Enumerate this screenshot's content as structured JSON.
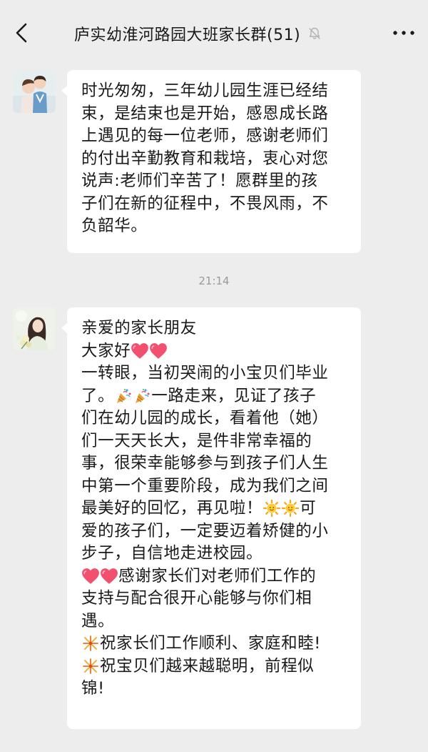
{
  "header": {
    "title": "庐实幼淮河路园大班家长群(51)"
  },
  "timestamp": "21:14",
  "message1": {
    "lines": [
      "时光匆匆，三年幼儿园生涯已经结",
      "束，是结束也是开始，感恩成长路",
      "上遇见的每一位老师，感谢老师们",
      "的付出辛勤教育和栽培，衷心对您",
      "说声:老师们辛苦了！愿群里的孩",
      "子们在新的征程中，不畏风雨，不",
      "负韶华。"
    ]
  },
  "message2": {
    "l1": "亲爱的家长朋友",
    "l2": "大家好",
    "l3": "一转眼，当初哭闹的小宝贝们毕业",
    "l4a": "了。",
    "l4b": "一路走来，见证了孩子",
    "l5": "们在幼儿园的成长，看着他（她）",
    "l6": "们一天天长大，是件非常幸福的",
    "l7": "事，很荣幸能够参与到孩子们人生",
    "l8": "中第一个重要阶段，成为我们之间",
    "l9a": "最美好的回忆，再见啦！",
    "l9b": "可",
    "l10": "爱的孩子们，一定要迈着矫健的小",
    "l11": "步子，自信地走进校园。",
    "l12": "感谢家长们对老师们工作的",
    "l13": "支持与配合很开心能够与你们相",
    "l14": "遇。",
    "l15": "祝家长们工作顺利、家庭和睦!",
    "l16": "祝宝贝们越来越聪明，前程似",
    "l17": "锦!"
  },
  "icons": {
    "heart_color": "#F2506E",
    "sun_color": "#F5A623",
    "popper_color": "#E8A33C",
    "firework_color": "#E8702A"
  }
}
